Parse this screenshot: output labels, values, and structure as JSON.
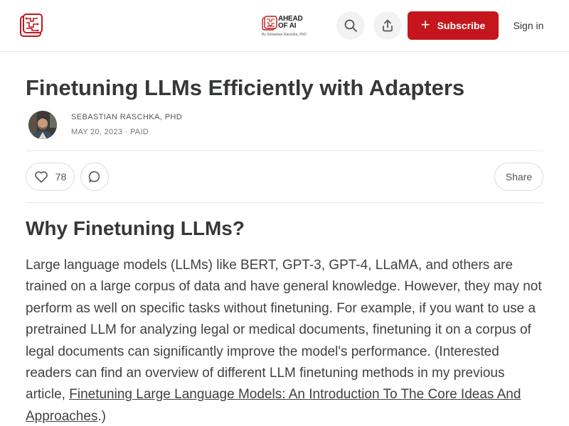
{
  "header": {
    "publication": {
      "name_line1": "AHEAD",
      "name_line2": "OF AI",
      "byline": "By Sebastian Raschka, PhD"
    },
    "site_icon": "chip-logo-icon",
    "search_icon": "search-icon",
    "share_icon": "share-upload-icon",
    "subscribe_label": "Subscribe",
    "subscribe_icon": "plus-icon",
    "signin_label": "Sign in",
    "brand_color": "#c4161c"
  },
  "post": {
    "title": "Finetuning LLMs Efficiently with Adapters",
    "author": "SEBASTIAN RASCHKA, PHD",
    "date": "MAY 20, 2023",
    "separator": "·",
    "access": "PAID",
    "avatar_icon": "author-avatar"
  },
  "actions": {
    "like_icon": "heart-icon",
    "like_count": "78",
    "comment_icon": "comment-icon",
    "share_label": "Share"
  },
  "content": {
    "heading": "Why Finetuning LLMs?",
    "paragraph_start": "Large language models (LLMs) like BERT, GPT-3, GPT-4, LLaMA, and others are trained on a large corpus of data and have general knowledge. However, they may not perform as well on specific tasks without finetuning. For example, if you want to use a pretrained LLM for analyzing legal or medical documents, finetuning it on a corpus of legal documents can significantly improve the model's performance. (Interested readers can find an overview of different LLM finetuning methods in my previous article, ",
    "link_text": "Finetuning Large Language Models: An Introduction To The Core Ideas And Approaches",
    "paragraph_end": ".)"
  }
}
